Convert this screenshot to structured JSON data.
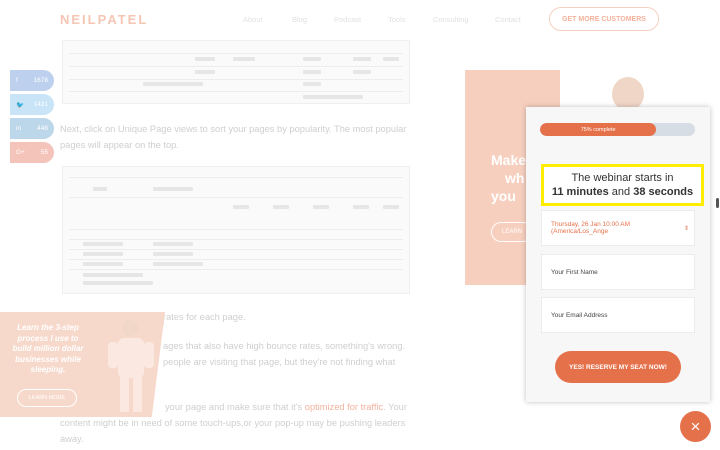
{
  "header": {
    "logo": "NEILPATEL",
    "nav": [
      "About",
      "Blog",
      "Podcast",
      "Tools",
      "Consulting",
      "Contact"
    ],
    "cta": "GET MORE CUSTOMERS"
  },
  "social": {
    "facebook": {
      "icon": "facebook-icon",
      "count": "1678"
    },
    "twitter": {
      "icon": "twitter-icon",
      "count": "1431"
    },
    "linkedin": {
      "icon": "linkedin-icon",
      "count": "448"
    },
    "google": {
      "icon": "google-plus-icon",
      "count": "55"
    }
  },
  "article": {
    "para1": "Next, click on Unique Page views to sort your pages by popularity. The most popular pages will appear on the top.",
    "para2_tail": "rates for each page.",
    "para3_a": "ages that also have high bounce rates, something's wrong.",
    "para3_b": "people are visiting that page, but they're not finding what",
    "para4_a": "your page and make sure that it's",
    "para4_link": "optimized for traffic",
    "para4_b": ". Your",
    "para5": "content might be in need of some touch-ups,or your pop-up may be pushing leaders",
    "para6": "away."
  },
  "ad_left": {
    "text": "Learn the 3-step process I use to build million dollar businesses while sleeping.",
    "button": "LEARN MORE"
  },
  "ad_right": {
    "text_lines": [
      "Make",
      "wh",
      "you"
    ],
    "button": "LEARN"
  },
  "modal": {
    "progress_label": "75% complete",
    "progress_value": 0.75,
    "countdown_prefix": "The webinar starts in",
    "minutes": "11 minutes",
    "and": "and",
    "seconds": "38 seconds",
    "date_select": "Thursday, 26 Jan 10:00 AM (America/Los_Ange",
    "first_name_placeholder": "Your First Name",
    "email_placeholder": "Your Email Address",
    "submit": "YES! RESERVE MY SEAT NOW!"
  },
  "close_button": "×",
  "colors": {
    "accent": "#e5714b",
    "highlight": "#ffee00"
  }
}
